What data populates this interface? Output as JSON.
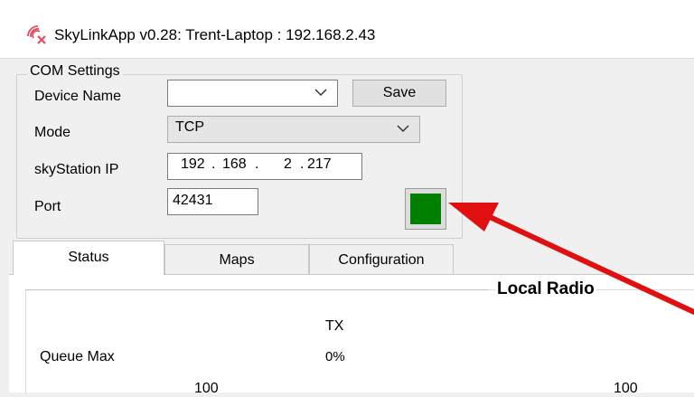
{
  "window": {
    "title": "SkyLinkApp v0.28: Trent-Laptop : 192.168.2.43",
    "icon": "skylink-antenna-icon"
  },
  "com_settings": {
    "legend": "COM Settings",
    "device_name": {
      "label": "Device Name",
      "value": ""
    },
    "save_label": "Save",
    "mode": {
      "label": "Mode",
      "value": "TCP"
    },
    "skystation_ip": {
      "label": "skyStation IP",
      "octets": [
        "192",
        "168",
        "2",
        "217"
      ],
      "separator": "."
    },
    "port": {
      "label": "Port",
      "value": "42431"
    },
    "connection_indicator": {
      "color": "#008000",
      "state": "connected"
    }
  },
  "tabs": [
    {
      "label": "Status",
      "active": true
    },
    {
      "label": "Maps",
      "active": false
    },
    {
      "label": "Configuration",
      "active": false
    }
  ],
  "status_panel": {
    "section_title": "Local Radio",
    "tx_header": "TX",
    "queue_max_label": "Queue Max",
    "queue_max_value": "0%",
    "scale_left": "100",
    "scale_right": "100"
  },
  "annotation": {
    "arrow_color": "#e01010",
    "points_to": "connection_indicator"
  }
}
